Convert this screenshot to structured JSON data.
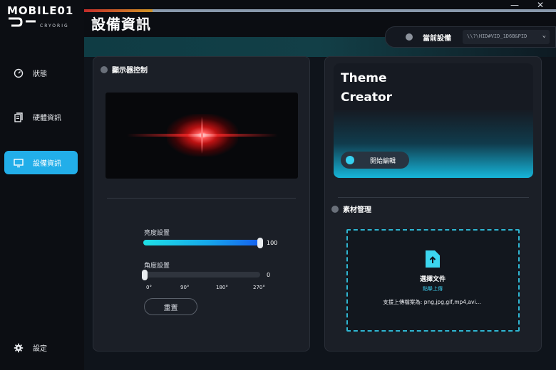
{
  "logo": {
    "brand": "MOBILE01",
    "sub": "CRYORIG"
  },
  "window": {
    "minimize": "—",
    "close": "✕"
  },
  "page_title": "設備資訊",
  "sidebar": {
    "items": [
      {
        "label": "狀態",
        "icon": "gauge-icon"
      },
      {
        "label": "硬體資訊",
        "icon": "document-icon"
      },
      {
        "label": "設備資訊",
        "icon": "monitor-icon",
        "active": true
      }
    ],
    "settings": {
      "label": "設定",
      "icon": "gear-icon"
    }
  },
  "device": {
    "label": "當前設備",
    "selected": "\\\\?\\HID#VID_1D6B&PID",
    "chevron": "⌄"
  },
  "display_control": {
    "title": "顯示器控制",
    "brightness": {
      "label": "亮度設置",
      "value": "100",
      "level": 100
    },
    "angle": {
      "label": "角度設置",
      "value": "0",
      "ticks": [
        "0°",
        "90°",
        "180°",
        "270°"
      ]
    },
    "reset_label": "重置"
  },
  "theme_creator": {
    "line1": "Theme",
    "line2": "Creator",
    "start_label": "開始編輯"
  },
  "assets": {
    "title": "素材管理",
    "drop_title": "選擇文件",
    "drop_link": "點擊上傳",
    "drop_hint": "支援上傳檔案為: png,jpg,gif,mp4,avi..."
  },
  "colors": {
    "accent": "#22aee9",
    "slider_start": "#1fe0e6",
    "slider_end": "#1560f0",
    "dash": "#2fb6d2"
  }
}
